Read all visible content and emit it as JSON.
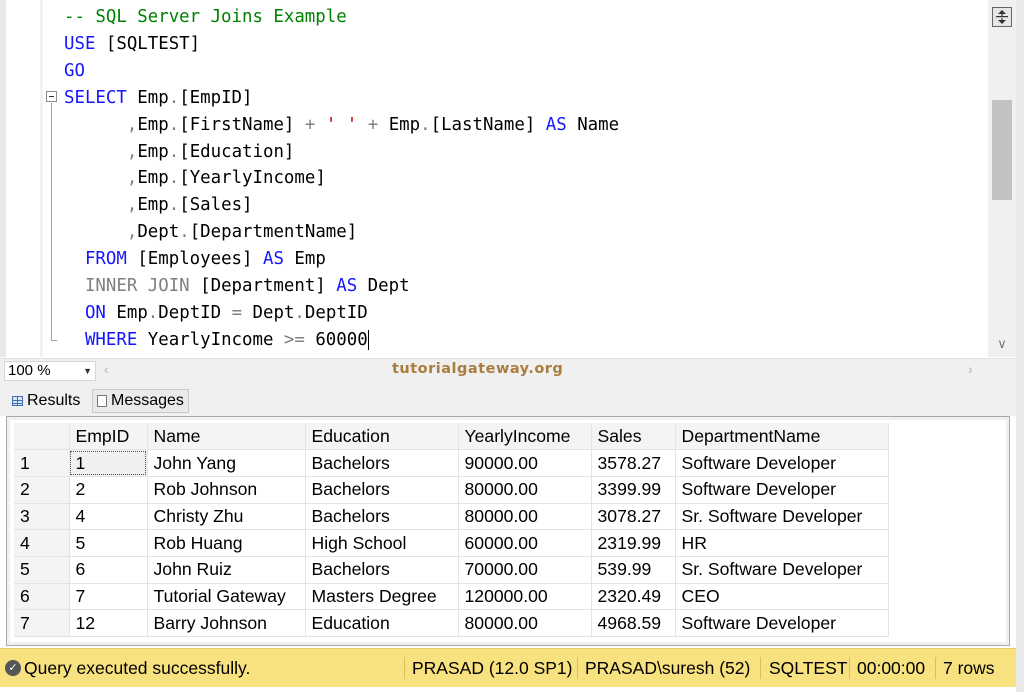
{
  "editor": {
    "lines": [
      {
        "parts": [
          {
            "t": "-- SQL Server Joins Example",
            "c": "cm"
          }
        ]
      },
      {
        "parts": [
          {
            "t": "USE",
            "c": "kw"
          },
          {
            "t": " [SQLTEST]",
            "c": ""
          }
        ]
      },
      {
        "parts": [
          {
            "t": "GO",
            "c": "kw"
          }
        ]
      },
      {
        "parts": [
          {
            "t": "SELECT",
            "c": "kw"
          },
          {
            "t": " Emp",
            "c": ""
          },
          {
            "t": ".",
            "c": "gr"
          },
          {
            "t": "[EmpID]",
            "c": ""
          }
        ]
      },
      {
        "parts": [
          {
            "t": "      ",
            "c": ""
          },
          {
            "t": ",",
            "c": "gr"
          },
          {
            "t": "Emp",
            "c": ""
          },
          {
            "t": ".",
            "c": "gr"
          },
          {
            "t": "[FirstName] ",
            "c": ""
          },
          {
            "t": "+",
            "c": "gr"
          },
          {
            "t": " ",
            "c": ""
          },
          {
            "t": "' '",
            "c": "st"
          },
          {
            "t": " ",
            "c": ""
          },
          {
            "t": "+",
            "c": "gr"
          },
          {
            "t": " Emp",
            "c": ""
          },
          {
            "t": ".",
            "c": "gr"
          },
          {
            "t": "[LastName] ",
            "c": ""
          },
          {
            "t": "AS",
            "c": "kw"
          },
          {
            "t": " Name",
            "c": ""
          }
        ]
      },
      {
        "parts": [
          {
            "t": "      ",
            "c": ""
          },
          {
            "t": ",",
            "c": "gr"
          },
          {
            "t": "Emp",
            "c": ""
          },
          {
            "t": ".",
            "c": "gr"
          },
          {
            "t": "[Education]",
            "c": ""
          }
        ]
      },
      {
        "parts": [
          {
            "t": "      ",
            "c": ""
          },
          {
            "t": ",",
            "c": "gr"
          },
          {
            "t": "Emp",
            "c": ""
          },
          {
            "t": ".",
            "c": "gr"
          },
          {
            "t": "[YearlyIncome]",
            "c": ""
          }
        ]
      },
      {
        "parts": [
          {
            "t": "      ",
            "c": ""
          },
          {
            "t": ",",
            "c": "gr"
          },
          {
            "t": "Emp",
            "c": ""
          },
          {
            "t": ".",
            "c": "gr"
          },
          {
            "t": "[Sales]",
            "c": ""
          }
        ]
      },
      {
        "parts": [
          {
            "t": "      ",
            "c": ""
          },
          {
            "t": ",",
            "c": "gr"
          },
          {
            "t": "Dept",
            "c": ""
          },
          {
            "t": ".",
            "c": "gr"
          },
          {
            "t": "[DepartmentName]",
            "c": ""
          }
        ]
      },
      {
        "parts": [
          {
            "t": "  ",
            "c": ""
          },
          {
            "t": "FROM",
            "c": "kw"
          },
          {
            "t": " [Employees] ",
            "c": ""
          },
          {
            "t": "AS",
            "c": "kw"
          },
          {
            "t": " Emp",
            "c": ""
          }
        ]
      },
      {
        "parts": [
          {
            "t": "  ",
            "c": ""
          },
          {
            "t": "INNER JOIN",
            "c": "gr"
          },
          {
            "t": " [Department] ",
            "c": ""
          },
          {
            "t": "AS",
            "c": "kw"
          },
          {
            "t": " Dept",
            "c": ""
          }
        ]
      },
      {
        "parts": [
          {
            "t": "  ",
            "c": ""
          },
          {
            "t": "ON",
            "c": "kw"
          },
          {
            "t": " Emp",
            "c": ""
          },
          {
            "t": ".",
            "c": "gr"
          },
          {
            "t": "DeptID ",
            "c": ""
          },
          {
            "t": "=",
            "c": "gr"
          },
          {
            "t": " Dept",
            "c": ""
          },
          {
            "t": ".",
            "c": "gr"
          },
          {
            "t": "DeptID",
            "c": ""
          }
        ]
      },
      {
        "parts": [
          {
            "t": "  ",
            "c": ""
          },
          {
            "t": "WHERE",
            "c": "kw"
          },
          {
            "t": " YearlyIncome ",
            "c": ""
          },
          {
            "t": ">=",
            "c": "gr"
          },
          {
            "t": " 60000",
            "c": ""
          }
        ]
      }
    ]
  },
  "zoom": {
    "value": "100 %"
  },
  "watermark": "tutorialgateway.org",
  "tabs": {
    "results": "Results",
    "messages": "Messages"
  },
  "results": {
    "columns": [
      "EmpID",
      "Name",
      "Education",
      "YearlyIncome",
      "Sales",
      "DepartmentName"
    ],
    "rows": [
      {
        "num": "1",
        "cells": [
          "1",
          "John Yang",
          "Bachelors",
          "90000.00",
          "3578.27",
          "Software Developer"
        ]
      },
      {
        "num": "2",
        "cells": [
          "2",
          "Rob Johnson",
          "Bachelors",
          "80000.00",
          "3399.99",
          "Software Developer"
        ]
      },
      {
        "num": "3",
        "cells": [
          "4",
          "Christy Zhu",
          "Bachelors",
          "80000.00",
          "3078.27",
          "Sr. Software Developer"
        ]
      },
      {
        "num": "4",
        "cells": [
          "5",
          "Rob Huang",
          "High School",
          "60000.00",
          "2319.99",
          "HR"
        ]
      },
      {
        "num": "5",
        "cells": [
          "6",
          "John Ruiz",
          "Bachelors",
          "70000.00",
          "539.99",
          "Sr. Software Developer"
        ]
      },
      {
        "num": "6",
        "cells": [
          "7",
          "Tutorial Gateway",
          "Masters Degree",
          "120000.00",
          "2320.49",
          "CEO"
        ]
      },
      {
        "num": "7",
        "cells": [
          "12",
          "Barry Johnson",
          "Education",
          "80000.00",
          "4968.59",
          "Software Developer"
        ]
      }
    ]
  },
  "status": {
    "message": "Query executed successfully.",
    "server": "PRASAD (12.0 SP1)",
    "user": "PRASAD\\suresh (52)",
    "database": "SQLTEST",
    "elapsed": "00:00:00",
    "row_count": "7 rows",
    "bar_color": "#f7e27f"
  },
  "icons": {
    "split": "split-view-icon",
    "status": "check-icon"
  }
}
